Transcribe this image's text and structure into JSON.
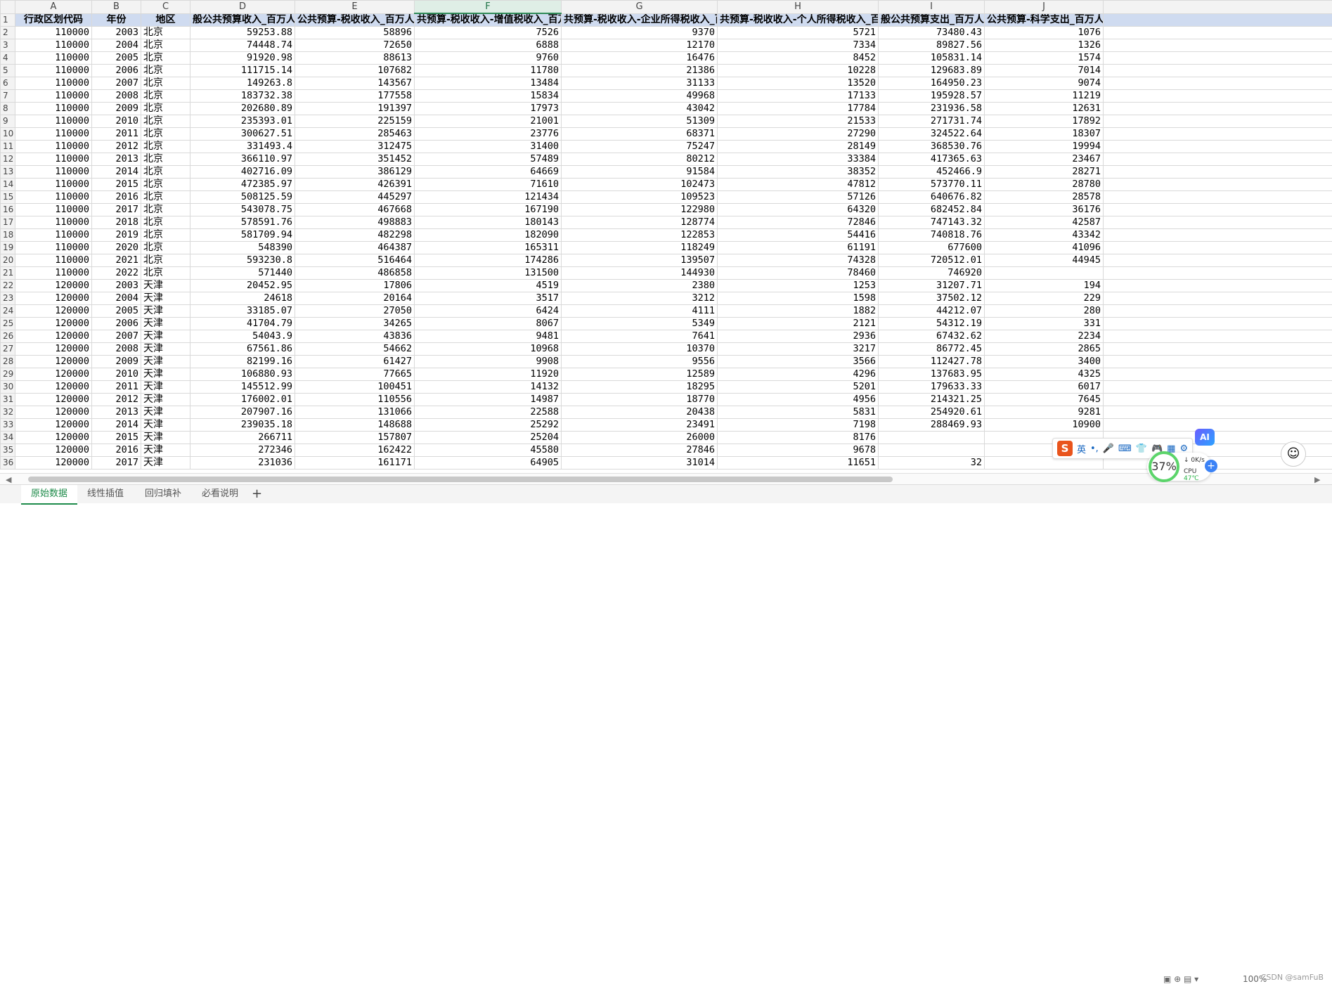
{
  "columns": [
    "A",
    "B",
    "C",
    "D",
    "E",
    "F",
    "G",
    "H",
    "I",
    "J"
  ],
  "selected_column": "F",
  "headers": [
    "行政区划代码",
    "年份",
    "地区",
    "般公共预算收入_百万人民",
    "公共预算-税收收入_百万人",
    "共预算-税收收入-增值税收入_百万",
    "共预算-税收收入-企业所得税收入_百万",
    "共预算-税收收入-个人所得税收入_百万",
    "般公共预算支出_百万人民",
    "公共预算-科学支出_百万人民"
  ],
  "rows": [
    [
      "110000",
      "2003",
      "北京",
      "59253.88",
      "58896",
      "7526",
      "9370",
      "5721",
      "73480.43",
      "1076"
    ],
    [
      "110000",
      "2004",
      "北京",
      "74448.74",
      "72650",
      "6888",
      "12170",
      "7334",
      "89827.56",
      "1326"
    ],
    [
      "110000",
      "2005",
      "北京",
      "91920.98",
      "88613",
      "9760",
      "16476",
      "8452",
      "105831.14",
      "1574"
    ],
    [
      "110000",
      "2006",
      "北京",
      "111715.14",
      "107682",
      "11780",
      "21386",
      "10228",
      "129683.89",
      "7014"
    ],
    [
      "110000",
      "2007",
      "北京",
      "149263.8",
      "143567",
      "13484",
      "31133",
      "13520",
      "164950.23",
      "9074"
    ],
    [
      "110000",
      "2008",
      "北京",
      "183732.38",
      "177558",
      "15834",
      "49968",
      "17133",
      "195928.57",
      "11219"
    ],
    [
      "110000",
      "2009",
      "北京",
      "202680.89",
      "191397",
      "17973",
      "43042",
      "17784",
      "231936.58",
      "12631"
    ],
    [
      "110000",
      "2010",
      "北京",
      "235393.01",
      "225159",
      "21001",
      "51309",
      "21533",
      "271731.74",
      "17892"
    ],
    [
      "110000",
      "2011",
      "北京",
      "300627.51",
      "285463",
      "23776",
      "68371",
      "27290",
      "324522.64",
      "18307"
    ],
    [
      "110000",
      "2012",
      "北京",
      "331493.4",
      "312475",
      "31400",
      "75247",
      "28149",
      "368530.76",
      "19994"
    ],
    [
      "110000",
      "2013",
      "北京",
      "366110.97",
      "351452",
      "57489",
      "80212",
      "33384",
      "417365.63",
      "23467"
    ],
    [
      "110000",
      "2014",
      "北京",
      "402716.09",
      "386129",
      "64669",
      "91584",
      "38352",
      "452466.9",
      "28271"
    ],
    [
      "110000",
      "2015",
      "北京",
      "472385.97",
      "426391",
      "71610",
      "102473",
      "47812",
      "573770.11",
      "28780"
    ],
    [
      "110000",
      "2016",
      "北京",
      "508125.59",
      "445297",
      "121434",
      "109523",
      "57126",
      "640676.82",
      "28578"
    ],
    [
      "110000",
      "2017",
      "北京",
      "543078.75",
      "467668",
      "167190",
      "122980",
      "64320",
      "682452.84",
      "36176"
    ],
    [
      "110000",
      "2018",
      "北京",
      "578591.76",
      "498883",
      "180143",
      "128774",
      "72846",
      "747143.32",
      "42587"
    ],
    [
      "110000",
      "2019",
      "北京",
      "581709.94",
      "482298",
      "182090",
      "122853",
      "54416",
      "740818.76",
      "43342"
    ],
    [
      "110000",
      "2020",
      "北京",
      "548390",
      "464387",
      "165311",
      "118249",
      "61191",
      "677600",
      "41096"
    ],
    [
      "110000",
      "2021",
      "北京",
      "593230.8",
      "516464",
      "174286",
      "139507",
      "74328",
      "720512.01",
      "44945"
    ],
    [
      "110000",
      "2022",
      "北京",
      "571440",
      "486858",
      "131500",
      "144930",
      "78460",
      "746920",
      ""
    ],
    [
      "120000",
      "2003",
      "天津",
      "20452.95",
      "17806",
      "4519",
      "2380",
      "1253",
      "31207.71",
      "194"
    ],
    [
      "120000",
      "2004",
      "天津",
      "24618",
      "20164",
      "3517",
      "3212",
      "1598",
      "37502.12",
      "229"
    ],
    [
      "120000",
      "2005",
      "天津",
      "33185.07",
      "27050",
      "6424",
      "4111",
      "1882",
      "44212.07",
      "280"
    ],
    [
      "120000",
      "2006",
      "天津",
      "41704.79",
      "34265",
      "8067",
      "5349",
      "2121",
      "54312.19",
      "331"
    ],
    [
      "120000",
      "2007",
      "天津",
      "54043.9",
      "43836",
      "9481",
      "7641",
      "2936",
      "67432.62",
      "2234"
    ],
    [
      "120000",
      "2008",
      "天津",
      "67561.86",
      "54662",
      "10968",
      "10370",
      "3217",
      "86772.45",
      "2865"
    ],
    [
      "120000",
      "2009",
      "天津",
      "82199.16",
      "61427",
      "9908",
      "9556",
      "3566",
      "112427.78",
      "3400"
    ],
    [
      "120000",
      "2010",
      "天津",
      "106880.93",
      "77665",
      "11920",
      "12589",
      "4296",
      "137683.95",
      "4325"
    ],
    [
      "120000",
      "2011",
      "天津",
      "145512.99",
      "100451",
      "14132",
      "18295",
      "5201",
      "179633.33",
      "6017"
    ],
    [
      "120000",
      "2012",
      "天津",
      "176002.01",
      "110556",
      "14987",
      "18770",
      "4956",
      "214321.25",
      "7645"
    ],
    [
      "120000",
      "2013",
      "天津",
      "207907.16",
      "131066",
      "22588",
      "20438",
      "5831",
      "254920.61",
      "9281"
    ],
    [
      "120000",
      "2014",
      "天津",
      "239035.18",
      "148688",
      "25292",
      "23491",
      "7198",
      "288469.93",
      "10900"
    ],
    [
      "120000",
      "2015",
      "天津",
      "266711",
      "157807",
      "25204",
      "26000",
      "8176",
      "",
      ""
    ],
    [
      "120000",
      "2016",
      "天津",
      "272346",
      "162422",
      "45580",
      "27846",
      "9678",
      "",
      "7"
    ],
    [
      "120000",
      "2017",
      "天津",
      "231036",
      "161171",
      "64905",
      "31014",
      "11651",
      "32",
      ""
    ]
  ],
  "sheet_tabs": [
    "原始数据",
    "线性插值",
    "回归填补",
    "必看说明"
  ],
  "active_tab": "原始数据",
  "add_tab_label": "+",
  "ime": {
    "label": "英"
  },
  "perf": {
    "percent": "37%",
    "net": "0K/s",
    "cpu_label": "CPU",
    "cpu_temp": "47℃"
  },
  "ai_badge": "AI",
  "watermark": "CSDN @samFuB",
  "zoom": "100%"
}
